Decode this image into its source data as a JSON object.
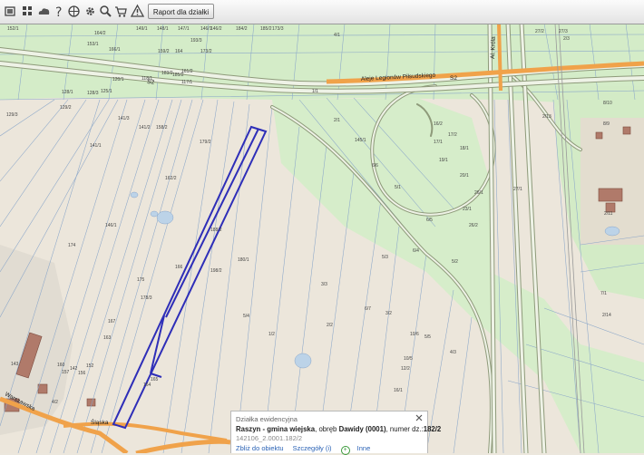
{
  "toolbar": {
    "report_label": "Raport dla działki",
    "tools": [
      "layers-icon",
      "grid-icon",
      "cloud-icon",
      "help-icon",
      "globe-icon",
      "settings-icon",
      "zoom-icon",
      "cart-icon",
      "warning-icon"
    ]
  },
  "map": {
    "road_labels": {
      "avenue": "Aleje Legionów Piłsudskiego",
      "s2_left": "S2",
      "s2_right": "S2",
      "krolow": "Al. Króla",
      "slaska": "Śląska",
      "warszawska": "Warszawska"
    },
    "parcel_labels": [
      "149/1",
      "148/1",
      "147/1",
      "146/1",
      "146/2",
      "184/2",
      "185/2",
      "173/3",
      "152/1",
      "164/2",
      "193/3",
      "153/1",
      "166/1",
      "159/2",
      "164",
      "173/2",
      "183/2",
      "161/2",
      "185/2",
      "129/3",
      "129/2",
      "128/1",
      "128/3",
      "125/1",
      "120/1",
      "118/1",
      "117/1",
      "141/3",
      "141/2",
      "158/2",
      "162/2",
      "179/2",
      "188/2",
      "198/2",
      "180/1",
      "1/1",
      "2/1",
      "145/1",
      "141/1",
      "146/1",
      "174",
      "175",
      "178/3",
      "166",
      "167",
      "163",
      "164",
      "165",
      "152",
      "160",
      "157",
      "156",
      "142",
      "143",
      "4/2",
      "4/1",
      "5/1",
      "6/6",
      "6/5",
      "6/4",
      "5/2",
      "5/3",
      "6/7",
      "3/2",
      "3/3",
      "2/2",
      "1/2",
      "5/4",
      "4/3",
      "5/5",
      "10/6",
      "10/5",
      "12/2",
      "16/1",
      "16/2",
      "17/1",
      "17/2",
      "18/1",
      "19/1",
      "20/1",
      "23/1",
      "26/2",
      "26/1",
      "27/1",
      "27/2",
      "27/3",
      "2/3",
      "2/13",
      "8/10",
      "8/9",
      "2/11",
      "7/1",
      "2/14"
    ]
  },
  "popup": {
    "title": "Działka ewidencyjna",
    "gmina": "Raszyn - gmina wiejska",
    "sep1": ", obręb",
    "obreb": "Dawidy (0001)",
    "sep2": ", numer dz.:",
    "parcel_number": "182/2",
    "code": "142106_2.0001.182/2",
    "links": {
      "zoom": "Zbliż do obiektu",
      "details": "Szczegóły (i)",
      "more": "Inne"
    }
  }
}
